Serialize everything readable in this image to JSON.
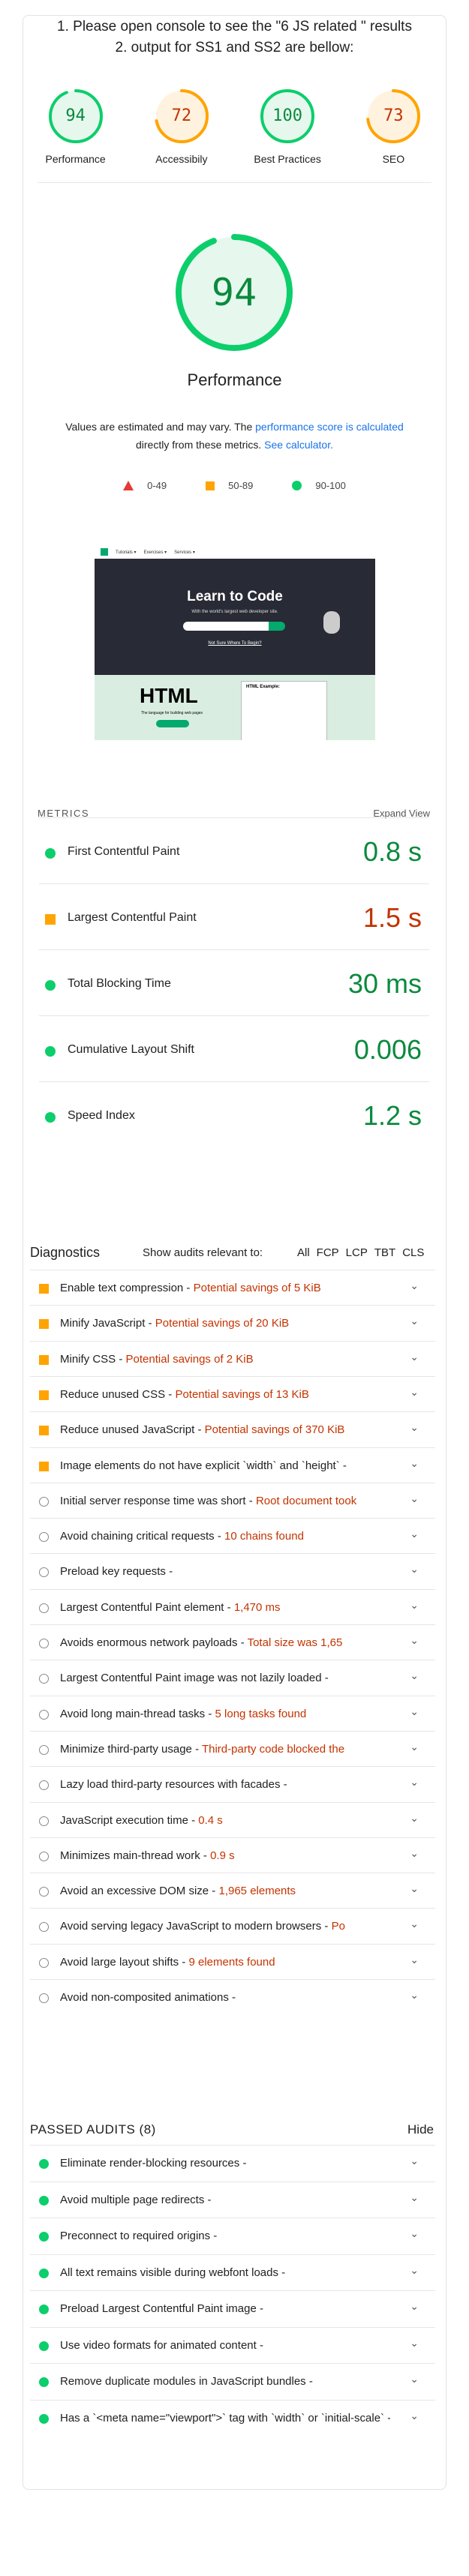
{
  "header": {
    "line1": "1. Please open console to see the \"6 JS related \" results",
    "line2": "2. output for SS1 and SS2 are bellow:"
  },
  "gauges": [
    {
      "score": "94",
      "label": "Performance",
      "color": "#0cce6b",
      "text_color": "#0a8a3d",
      "fill": 0.94
    },
    {
      "score": "72",
      "label": "Accessibily",
      "color": "#ffa400",
      "text_color": "#c33300",
      "fill": 0.72
    },
    {
      "score": "100",
      "label": "Best Practices",
      "color": "#0cce6b",
      "text_color": "#0a8a3d",
      "fill": 1.0
    },
    {
      "score": "73",
      "label": "SEO",
      "color": "#ffa400",
      "text_color": "#c33300",
      "fill": 0.73
    }
  ],
  "performance": {
    "score": "94",
    "fill": 0.94,
    "title": "Performance",
    "est_text_1": "Values are estimated and may vary. The ",
    "est_link_1": "performance score is calculated",
    "est_text_2": "directly from these metrics. ",
    "est_link_2": "See calculator."
  },
  "legend": [
    {
      "range": "0-49",
      "icon": "triangle-red-icon"
    },
    {
      "range": "50-89",
      "icon": "square-orange-icon"
    },
    {
      "range": "90-100",
      "icon": "circle-green-icon"
    }
  ],
  "screenshot": {
    "nav_items": [
      "Tutorials ▾",
      "Exercises ▾",
      "Services ▾"
    ],
    "hero_title": "Learn to Code",
    "hero_sub": "With the world's largest web developer site.",
    "hero_link": "Not Sure Where To Begin?",
    "lower_title": "HTML",
    "lower_text": "The language for building web pages",
    "examples_title": "HTML Example:"
  },
  "metrics": {
    "heading": "METRICS",
    "expand_label": "Expand View",
    "items": [
      {
        "label": "First Contentful Paint",
        "value": "0.8 s",
        "status": "good"
      },
      {
        "label": "Largest Contentful Paint",
        "value": "1.5 s",
        "status": "average"
      },
      {
        "label": "Total Blocking Time",
        "value": "30 ms",
        "status": "good"
      },
      {
        "label": "Cumulative Layout Shift",
        "value": "0.006",
        "status": "good"
      },
      {
        "label": "Speed Index",
        "value": "1.2 s",
        "status": "good"
      }
    ]
  },
  "diagnostics": {
    "heading": "Diagnostics",
    "show_label": "Show audits relevant to:",
    "filters": [
      "All",
      "FCP",
      "LCP",
      "TBT",
      "CLS"
    ],
    "audits": [
      {
        "title": "Enable text compression",
        "savings": "Potential savings of 5 KiB",
        "status": "average"
      },
      {
        "title": "Minify JavaScript",
        "savings": "Potential savings of 20 KiB",
        "status": "average"
      },
      {
        "title": "Minify CSS",
        "savings": "Potential savings of 2 KiB",
        "status": "average"
      },
      {
        "title": "Reduce unused CSS",
        "savings": "Potential savings of 13 KiB",
        "status": "average"
      },
      {
        "title": "Reduce unused JavaScript",
        "savings": "Potential savings of 370 KiB",
        "status": "average"
      },
      {
        "title": "Image elements do not have explicit `width` and `height`",
        "savings": "",
        "status": "average"
      },
      {
        "title": "Initial server response time was short",
        "savings": "Root document took",
        "status": "info"
      },
      {
        "title": "Avoid chaining critical requests",
        "savings": "10 chains found",
        "status": "info"
      },
      {
        "title": "Preload key requests",
        "savings": "",
        "status": "info"
      },
      {
        "title": "Largest Contentful Paint element",
        "savings": "1,470 ms",
        "status": "info"
      },
      {
        "title": "Avoids enormous network payloads",
        "savings": "Total size was 1,65",
        "status": "info"
      },
      {
        "title": "Largest Contentful Paint image was not lazily loaded",
        "savings": "",
        "status": "info"
      },
      {
        "title": "Avoid long main-thread tasks",
        "savings": "5 long tasks found",
        "status": "info"
      },
      {
        "title": "Minimize third-party usage",
        "savings": "Third-party code blocked the",
        "status": "info"
      },
      {
        "title": "Lazy load third-party resources with facades",
        "savings": "",
        "status": "info"
      },
      {
        "title": "JavaScript execution time",
        "savings": "0.4 s",
        "status": "info"
      },
      {
        "title": "Minimizes main-thread work",
        "savings": "0.9 s",
        "status": "info"
      },
      {
        "title": "Avoid an excessive DOM size",
        "savings": "1,965 elements",
        "status": "info"
      },
      {
        "title": "Avoid serving legacy JavaScript to modern browsers",
        "savings": "Po",
        "status": "info"
      },
      {
        "title": "Avoid large layout shifts",
        "savings": "9 elements found",
        "status": "info"
      },
      {
        "title": "Avoid non-composited animations",
        "savings": "",
        "status": "info"
      }
    ]
  },
  "passed": {
    "heading": "PASSED AUDITS (8)",
    "hide_label": "Hide",
    "audits": [
      {
        "title": "Eliminate render-blocking resources"
      },
      {
        "title": "Avoid multiple page redirects"
      },
      {
        "title": "Preconnect to required origins"
      },
      {
        "title": "All text remains visible during webfont loads"
      },
      {
        "title": "Preload Largest Contentful Paint image"
      },
      {
        "title": "Use video formats for animated content"
      },
      {
        "title": "Remove duplicate modules in JavaScript bundles"
      },
      {
        "title": "Has a `<meta name=\"viewport\">` tag with `width` or `initial-scale`"
      }
    ]
  },
  "colors": {
    "good": "#0cce6b",
    "average": "#ffa400",
    "fail": "#ff4e42",
    "good_text": "#0a8a3d",
    "average_text": "#c33300"
  }
}
